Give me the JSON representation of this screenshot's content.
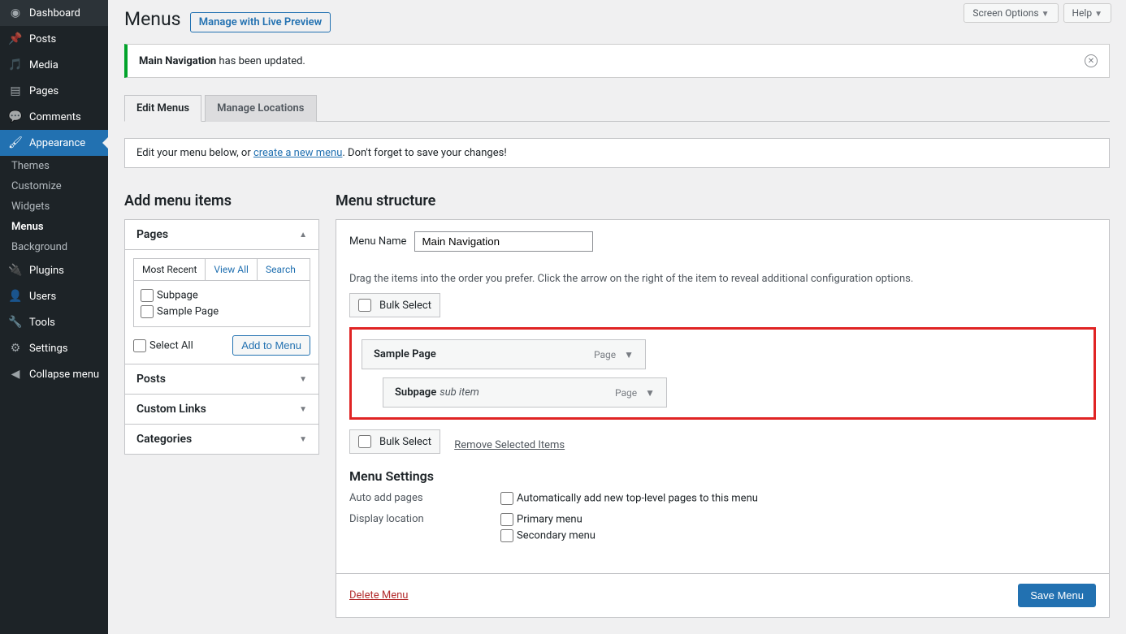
{
  "top_tabs": {
    "screen_options": "Screen Options",
    "help": "Help"
  },
  "sidebar": {
    "items": [
      {
        "label": "Dashboard"
      },
      {
        "label": "Posts"
      },
      {
        "label": "Media"
      },
      {
        "label": "Pages"
      },
      {
        "label": "Comments"
      },
      {
        "label": "Appearance"
      },
      {
        "label": "Plugins"
      },
      {
        "label": "Users"
      },
      {
        "label": "Tools"
      },
      {
        "label": "Settings"
      },
      {
        "label": "Collapse menu"
      }
    ],
    "appearance_sub": [
      "Themes",
      "Customize",
      "Widgets",
      "Menus",
      "Background"
    ]
  },
  "page": {
    "title": "Menus",
    "live_preview": "Manage with Live Preview",
    "notice_strong": "Main Navigation",
    "notice_rest": " has been updated.",
    "tabs": {
      "edit": "Edit Menus",
      "locations": "Manage Locations"
    },
    "hint_pre": "Edit your menu below, or ",
    "hint_link": "create a new menu",
    "hint_post": ". Don't forget to save your changes!"
  },
  "left": {
    "heading": "Add menu items",
    "pages": "Pages",
    "posts": "Posts",
    "custom_links": "Custom Links",
    "categories": "Categories",
    "inner_tabs": {
      "recent": "Most Recent",
      "view_all": "View All",
      "search": "Search"
    },
    "items": [
      "Subpage",
      "Sample Page"
    ],
    "select_all": "Select All",
    "add_btn": "Add to Menu"
  },
  "right": {
    "heading": "Menu structure",
    "name_label": "Menu Name",
    "name_value": "Main Navigation",
    "drag_hint": "Drag the items into the order you prefer. Click the arrow on the right of the item to reveal additional configuration options.",
    "bulk_select": "Bulk Select",
    "remove_selected": "Remove Selected Items",
    "menu_items": [
      {
        "title": "Sample Page",
        "type": "Page"
      },
      {
        "title": "Subpage",
        "sub": "sub item",
        "type": "Page"
      }
    ],
    "settings_heading": "Menu Settings",
    "auto_add_label": "Auto add pages",
    "auto_add_opt": "Automatically add new top-level pages to this menu",
    "display_label": "Display location",
    "loc_primary": "Primary menu",
    "loc_secondary": "Secondary menu",
    "delete": "Delete Menu",
    "save": "Save Menu"
  }
}
